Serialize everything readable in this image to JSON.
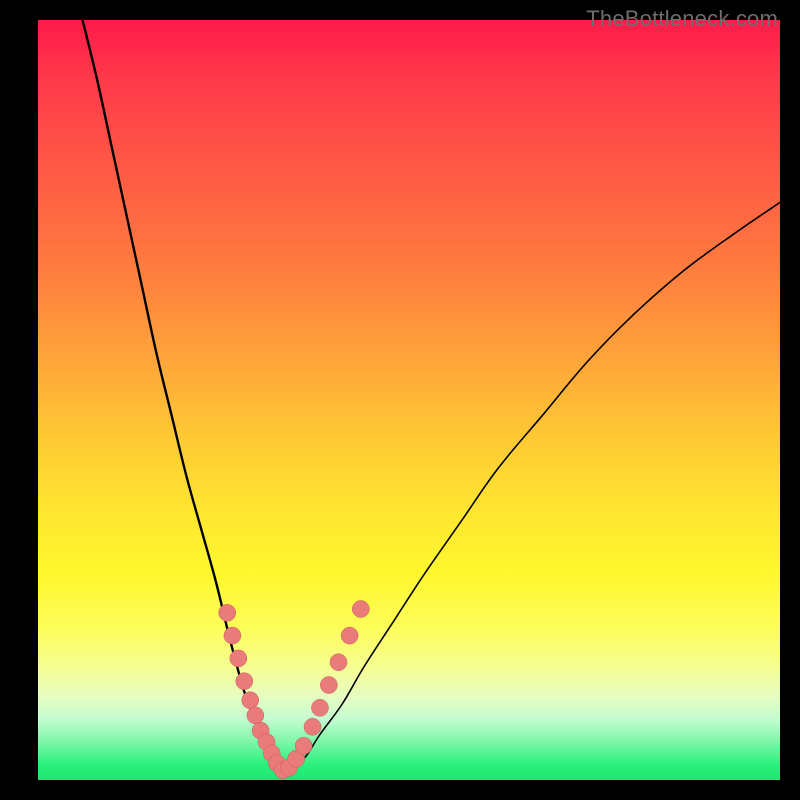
{
  "watermark": "TheBottleneck.com",
  "colors": {
    "frame": "#000000",
    "curve_stroke": "#000000",
    "marker_fill": "#ea7b7b",
    "marker_stroke": "#c95a5a",
    "near_top": "#ff1a4a",
    "near_bottom": "#1fe671"
  },
  "chart_data": {
    "type": "line",
    "title": "",
    "xlabel": "",
    "ylabel": "",
    "xlim": [
      0,
      100
    ],
    "ylim": [
      0,
      100
    ],
    "grid": false,
    "legend": false,
    "note": "V-shaped bottleneck curve on rainbow gradient; minimum near x≈33. Tick labels are not visible in the image; values are pixel-space proportions (0–100) estimated from the figure.",
    "series": [
      {
        "name": "left-branch",
        "x": [
          6,
          8,
          10,
          12,
          14,
          16,
          18,
          20,
          22,
          24,
          26,
          28,
          30,
          31,
          32,
          33
        ],
        "y": [
          100,
          92,
          83,
          74,
          65,
          56,
          48,
          40,
          33,
          26,
          18,
          11,
          6,
          3,
          1.5,
          1
        ]
      },
      {
        "name": "right-branch",
        "x": [
          33,
          34,
          36,
          38,
          41,
          44,
          48,
          52,
          57,
          62,
          68,
          74,
          80,
          87,
          94,
          100
        ],
        "y": [
          1,
          1.5,
          3,
          6,
          10,
          15,
          21,
          27,
          34,
          41,
          48,
          55,
          61,
          67,
          72,
          76
        ]
      }
    ],
    "markers": {
      "name": "highlight-points",
      "x": [
        25.5,
        26.2,
        27.0,
        27.8,
        28.6,
        29.3,
        30.0,
        30.8,
        31.5,
        32.2,
        33.0,
        33.8,
        34.8,
        35.8,
        37.0,
        38.0,
        39.2,
        40.5,
        42.0,
        43.5
      ],
      "y": [
        22,
        19,
        16,
        13,
        10.5,
        8.5,
        6.5,
        5,
        3.5,
        2.2,
        1.3,
        1.6,
        2.8,
        4.5,
        7,
        9.5,
        12.5,
        15.5,
        19,
        22.5
      ]
    }
  }
}
